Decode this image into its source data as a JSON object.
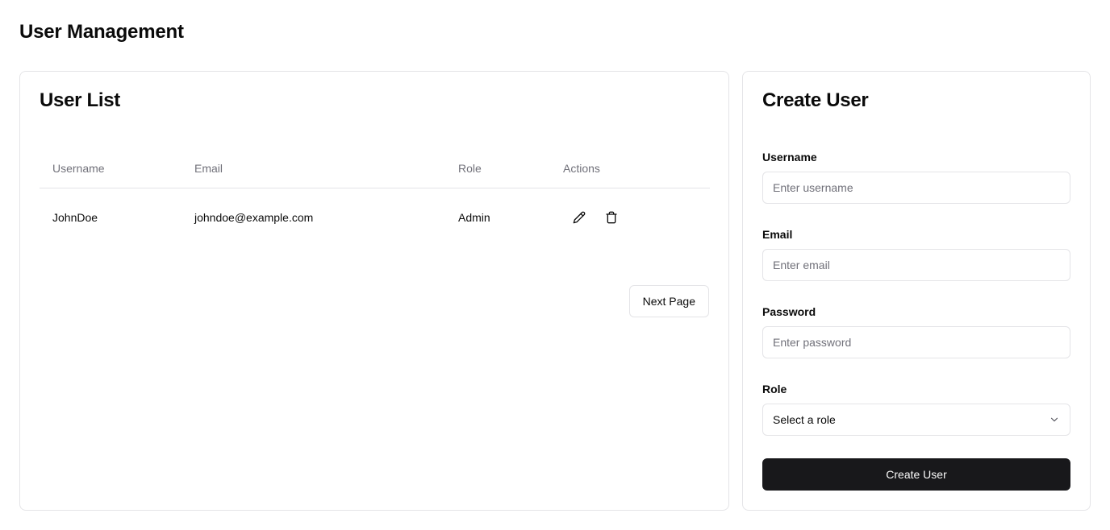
{
  "page": {
    "title": "User Management"
  },
  "user_list": {
    "title": "User List",
    "columns": [
      "Username",
      "Email",
      "Role",
      "Actions"
    ],
    "rows": [
      {
        "username": "JohnDoe",
        "email": "johndoe@example.com",
        "role": "Admin"
      }
    ],
    "next_page_label": "Next Page",
    "icons": {
      "edit": "pencil-icon",
      "delete": "trash-icon"
    }
  },
  "create_user": {
    "title": "Create User",
    "username": {
      "label": "Username",
      "placeholder": "Enter username",
      "value": ""
    },
    "email": {
      "label": "Email",
      "placeholder": "Enter email",
      "value": ""
    },
    "password": {
      "label": "Password",
      "placeholder": "Enter password",
      "value": ""
    },
    "role": {
      "label": "Role",
      "selected": "Select a role",
      "icon": "chevron-down-icon"
    },
    "submit_label": "Create User"
  },
  "colors": {
    "border": "#e4e4e7",
    "muted_text": "#71717a",
    "primary_button": "#18181b",
    "primary_button_text": "#fafafa"
  }
}
